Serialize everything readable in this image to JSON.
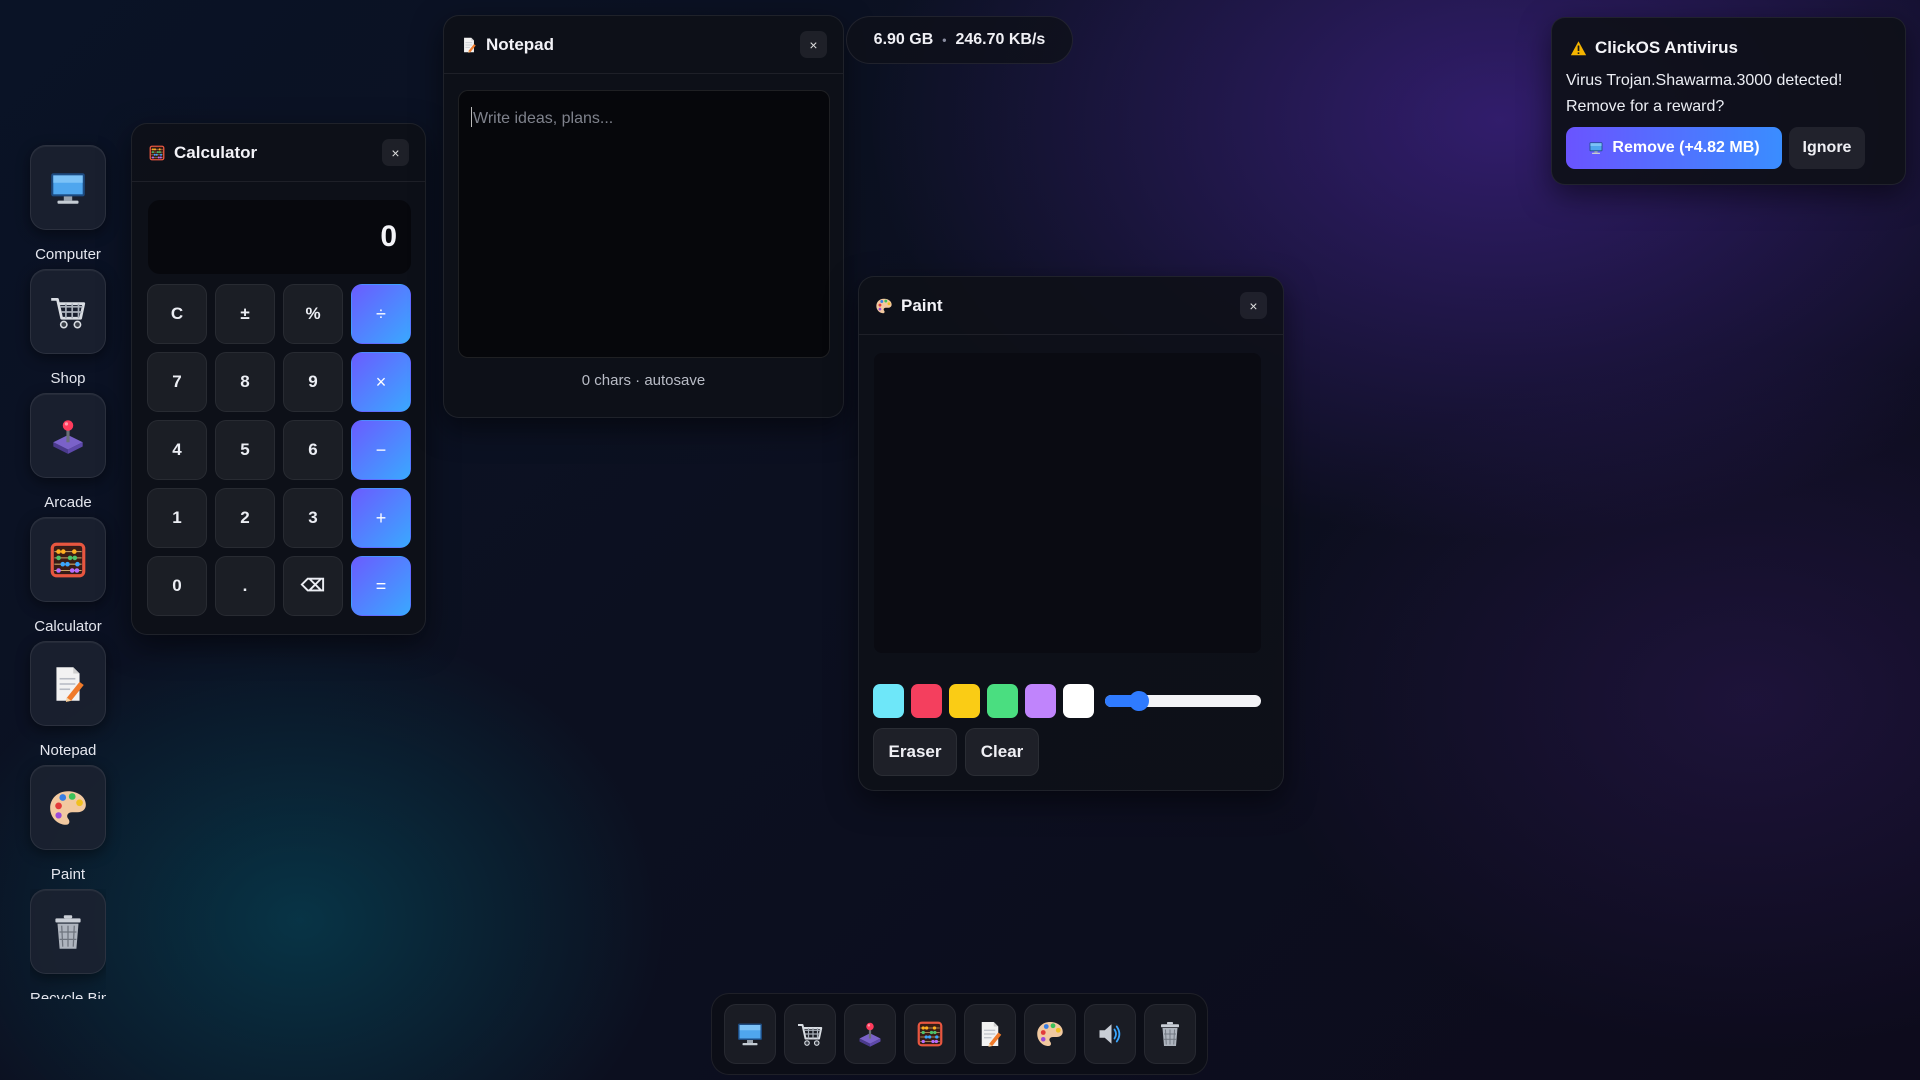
{
  "desktop": {
    "icons": [
      {
        "label": "Computer",
        "icon": "monitor-icon"
      },
      {
        "label": "Shop",
        "icon": "cart-icon"
      },
      {
        "label": "Arcade",
        "icon": "joystick-icon"
      },
      {
        "label": "Calculator",
        "icon": "abacus-icon"
      },
      {
        "label": "Notepad",
        "icon": "notepad-icon"
      },
      {
        "label": "Paint",
        "icon": "palette-icon"
      },
      {
        "label": "Recycle Bin",
        "icon": "trash-icon"
      }
    ]
  },
  "calculator": {
    "title": "Calculator",
    "close_label": "×",
    "display": "0",
    "keys": [
      "C",
      "±",
      "%",
      "÷",
      "7",
      "8",
      "9",
      "×",
      "4",
      "5",
      "6",
      "−",
      "1",
      "2",
      "3",
      "+",
      "0",
      ".",
      "⌫",
      "="
    ]
  },
  "notepad": {
    "title": "Notepad",
    "close_label": "×",
    "placeholder": "Write ideas, plans...",
    "status": "0 chars · autosave"
  },
  "storage": {
    "size": "6.90 GB",
    "separator": "•",
    "speed": "246.70 KB/s"
  },
  "paint": {
    "title": "Paint",
    "close_label": "×",
    "colors": [
      "#6ee7f9",
      "#f43f5e",
      "#facc15",
      "#4ade80",
      "#c084fc",
      "#ffffff"
    ],
    "brush_size_fraction": 0.18,
    "eraser_label": "Eraser",
    "clear_label": "Clear"
  },
  "antivirus": {
    "title": "ClickOS Antivirus",
    "message": "Virus Trojan.Shawarma.3000 detected! Remove for a reward?",
    "remove_label": "Remove (+4.82 MB)",
    "ignore_label": "Ignore",
    "accent": "#6a54ff"
  },
  "taskbar": {
    "items": [
      "monitor-icon",
      "cart-icon",
      "joystick-icon",
      "abacus-icon",
      "notepad-icon",
      "palette-icon",
      "speaker-icon",
      "trash-icon"
    ]
  }
}
